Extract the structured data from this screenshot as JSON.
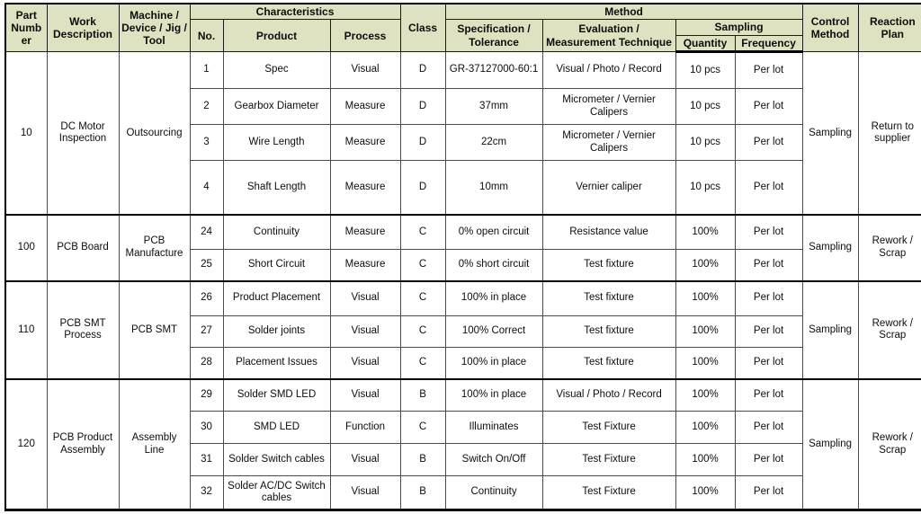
{
  "document": {
    "type": "control-plan-table",
    "header_background": "#dee2c0",
    "border_color": "#000000",
    "text_color": "#0d0d0d"
  },
  "header": {
    "group_row": {
      "part_number": "Part Number",
      "work_description": "Work Description",
      "machine": "Machine / Device / Jig / Tool",
      "characteristics": "Characteristics",
      "class": "Class",
      "method": "Method",
      "control_method": "Control Method",
      "reaction_plan": "Reaction Plan"
    },
    "sub_row": {
      "no": "No.",
      "product": "Product",
      "process": "Process",
      "specification": "Specification / Tolerance",
      "evaluation": "Evaluation / Measurement Technique",
      "sampling": "Sampling"
    },
    "sub_sub_row": {
      "quantity": "Quantity",
      "frequency": "Frequency"
    }
  },
  "groups": [
    {
      "part_number": "10",
      "work_description": "DC Motor Inspection",
      "machine": "Outsourcing",
      "control_method": "Sampling",
      "reaction_plan": "Return to supplier",
      "rows": [
        {
          "no": "1",
          "product": "Spec",
          "process": "Visual",
          "class": "D",
          "specification": "GR-37127000-60:1",
          "evaluation": "Visual / Photo / Record",
          "quantity": "10 pcs",
          "frequency": "Per lot"
        },
        {
          "no": "2",
          "product": "Gearbox Diameter",
          "process": "Measure",
          "class": "D",
          "specification": "37mm",
          "evaluation": "Micrometer / Vernier Calipers",
          "quantity": "10 pcs",
          "frequency": "Per lot"
        },
        {
          "no": "3",
          "product": "Wire Length",
          "process": "Measure",
          "class": "D",
          "specification": "22cm",
          "evaluation": "Micrometer / Vernier Calipers",
          "quantity": "10 pcs",
          "frequency": "Per lot"
        },
        {
          "no": "4",
          "product": "Shaft Length",
          "process": "Measure",
          "class": "D",
          "specification": "10mm",
          "evaluation": "Vernier caliper",
          "quantity": "10 pcs",
          "frequency": "Per lot"
        }
      ]
    },
    {
      "part_number": "100",
      "work_description": "PCB Board",
      "machine": "PCB Manufacture",
      "control_method": "Sampling",
      "reaction_plan": "Rework / Scrap",
      "rows": [
        {
          "no": "24",
          "product": "Continuity",
          "process": "Measure",
          "class": "C",
          "specification": "0% open circuit",
          "evaluation": "Resistance value",
          "quantity": "100%",
          "frequency": "Per lot"
        },
        {
          "no": "25",
          "product": "Short Circuit",
          "process": "Measure",
          "class": "C",
          "specification": "0% short circuit",
          "evaluation": "Test fixture",
          "quantity": "100%",
          "frequency": "Per lot"
        }
      ]
    },
    {
      "part_number": "110",
      "work_description": "PCB SMT Process",
      "machine": "PCB SMT",
      "control_method": "Sampling",
      "reaction_plan": "Rework / Scrap",
      "rows": [
        {
          "no": "26",
          "product": "Product Placement",
          "process": "Visual",
          "class": "C",
          "specification": "100% in place",
          "evaluation": "Test fixture",
          "quantity": "100%",
          "frequency": "Per lot"
        },
        {
          "no": "27",
          "product": "Solder joints",
          "process": "Visual",
          "class": "C",
          "specification": "100% Correct",
          "evaluation": "Test fixture",
          "quantity": "100%",
          "frequency": "Per lot"
        },
        {
          "no": "28",
          "product": "Placement Issues",
          "process": "Visual",
          "class": "C",
          "specification": "100% in place",
          "evaluation": "Test fixture",
          "quantity": "100%",
          "frequency": "Per lot"
        }
      ]
    },
    {
      "part_number": "120",
      "work_description": "PCB Product Assembly",
      "machine": "Assembly Line",
      "control_method": "Sampling",
      "reaction_plan": "Rework / Scrap",
      "rows": [
        {
          "no": "29",
          "product": "Solder SMD LED",
          "process": "Visual",
          "class": "B",
          "specification": "100% in place",
          "evaluation": "Visual / Photo / Record",
          "quantity": "100%",
          "frequency": "Per lot"
        },
        {
          "no": "30",
          "product": "SMD LED",
          "process": "Function",
          "class": "C",
          "specification": "Illuminates",
          "evaluation": "Test Fixture",
          "quantity": "100%",
          "frequency": "Per lot"
        },
        {
          "no": "31",
          "product": "Solder Switch cables",
          "process": "Visual",
          "class": "B",
          "specification": "Switch On/Off",
          "evaluation": "Test Fixture",
          "quantity": "100%",
          "frequency": "Per lot"
        },
        {
          "no": "32",
          "product": "Solder AC/DC Switch cables",
          "process": "Visual",
          "class": "B",
          "specification": "Continuity",
          "evaluation": "Test Fixture",
          "quantity": "100%",
          "frequency": "Per lot"
        }
      ]
    }
  ]
}
